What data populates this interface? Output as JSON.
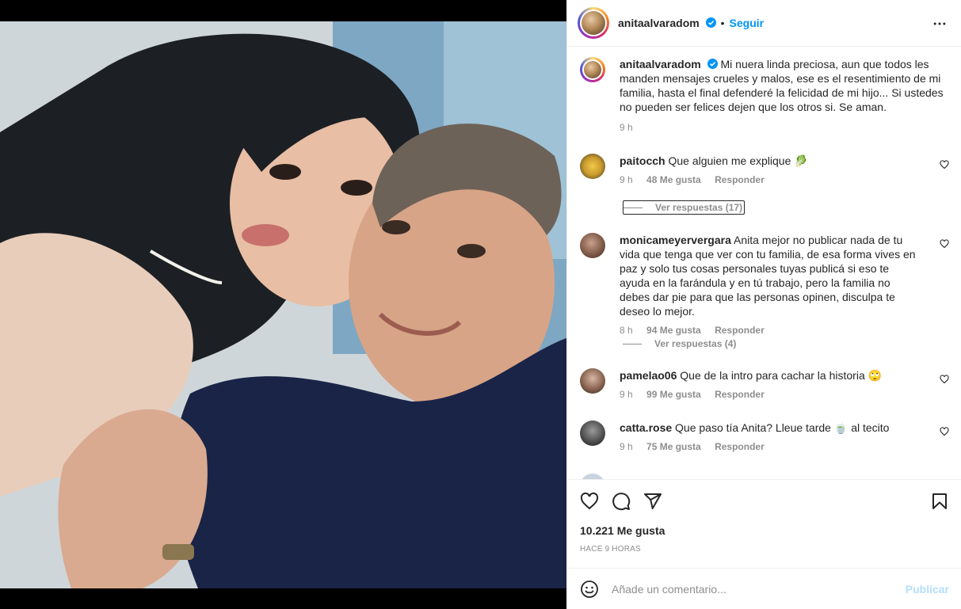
{
  "post": {
    "username": "anitaalvaradom",
    "follow_label": "Seguir",
    "separator": "•"
  },
  "caption": {
    "username": "anitaalvaradom",
    "text": "Mi nuera linda preciosa, aun que todos les manden mensajes crueles y malos, ese es el resentimiento de mi familia, hasta el final defenderé la felicidad de mi hijo... Si ustedes no pueden ser felices dejen que los otros si. Se aman.",
    "time": "9 h"
  },
  "comments": [
    {
      "username": "paitocch",
      "text": "Que alguien me explique",
      "emoji": "🥬",
      "time": "9 h",
      "likes": "48 Me gusta",
      "reply": "Responder",
      "replies_label": "Ver respuestas (17)"
    },
    {
      "username": "monicameyervergara",
      "text": "Anita mejor no publicar nada de tu vida que tenga que ver con tu familia, de esa forma vives en paz y solo tus cosas personales tuyas publicá si eso te ayuda en la farándula y en tú trabajo, pero la familia no debes dar pie para que las personas opinen, disculpa te deseo lo mejor.",
      "emoji": "",
      "time": "8 h",
      "likes": "94 Me gusta",
      "reply": "Responder",
      "replies_label": "Ver respuestas (4)"
    },
    {
      "username": "pamelao06",
      "text": "Que de la intro para cachar la historia",
      "emoji": "🙄",
      "time": "9 h",
      "likes": "99 Me gusta",
      "reply": "Responder",
      "replies_label": ""
    },
    {
      "username": "catta.rose",
      "text": "Que paso tía Anita? Lleue tarde",
      "emoji": "🍵",
      "text_after": "al tecito",
      "time": "9 h",
      "likes": "75 Me gusta",
      "reply": "Responder",
      "replies_label": ""
    }
  ],
  "stats": {
    "likes": "10.221 Me gusta",
    "posted": "HACE 9 HORAS"
  },
  "composer": {
    "placeholder": "Añade un comentario...",
    "publish_label": "Publicar"
  },
  "colors": {
    "accent": "#0095f6",
    "publish_disabled": "#b2dffc",
    "muted": "#8e8e8e",
    "text": "#262626"
  },
  "icons": [
    "more-icon",
    "verified-icon",
    "heart-icon",
    "comment-icon",
    "share-icon",
    "bookmark-icon",
    "emoji-icon"
  ]
}
